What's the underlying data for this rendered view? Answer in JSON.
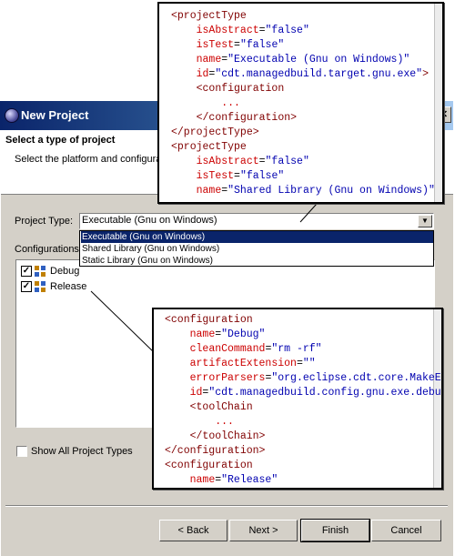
{
  "window": {
    "title": "New Project",
    "close_glyph": "✕"
  },
  "header": {
    "title": "Select a type of project",
    "description": "Select the platform and configura"
  },
  "form": {
    "project_type_label": "Project Type:",
    "project_type_value": "Executable (Gnu on Windows)",
    "dropdown_options": [
      "Executable (Gnu on Windows)",
      "Shared Library (Gnu on Windows)",
      "Static Library (Gnu on Windows)"
    ],
    "configurations_label": "Configurations",
    "configurations": [
      {
        "label": "Debug",
        "checked": true
      },
      {
        "label": "Release",
        "checked": true
      }
    ],
    "show_all_label": "Show All Project Types",
    "show_all_checked": false
  },
  "buttons": {
    "back": "< Back",
    "next": "Next >",
    "finish": "Finish",
    "cancel": "Cancel"
  },
  "callout_project_type": {
    "lines": [
      "<projectType",
      "    isAbstract=\"false\"",
      "    isTest=\"false\"",
      "    name=\"Executable (Gnu on Windows)\"",
      "    id=\"cdt.managedbuild.target.gnu.exe\">",
      "    <configuration",
      "        ...",
      "    </configuration>",
      "</projectType>",
      "<projectType",
      "    isAbstract=\"false\"",
      "    isTest=\"false\"",
      "    name=\"Shared Library (Gnu on Windows)\""
    ]
  },
  "callout_configuration": {
    "lines": [
      "<configuration",
      "    name=\"Debug\"",
      "    cleanCommand=\"rm -rf\"",
      "    artifactExtension=\"\"",
      "    errorParsers=\"org.eclipse.cdt.core.MakeErrorParser\"",
      "    id=\"cdt.managedbuild.config.gnu.exe.debug\"",
      "    <toolChain",
      "        ...",
      "    </toolChain>",
      "</configuration>",
      "<configuration",
      "    name=\"Release\""
    ]
  },
  "colors": {
    "tag": "#800000",
    "attribute": "#cc0000",
    "value": "#0000b0",
    "selection": "#0a246a",
    "dialog_bg": "#d4d0c8"
  }
}
